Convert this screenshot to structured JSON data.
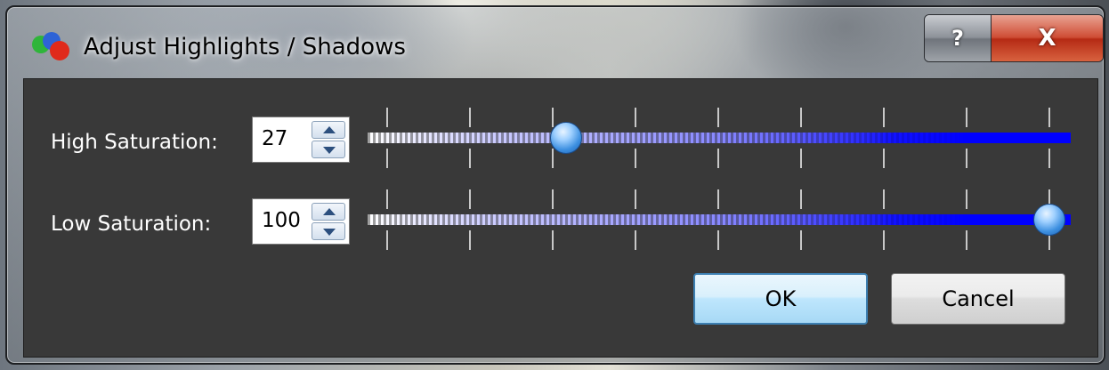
{
  "window": {
    "title": "Adjust Highlights / Shadows",
    "help_label": "?",
    "close_label": "X"
  },
  "controls": {
    "high": {
      "label": "High Saturation:",
      "value": "27",
      "slider_percent": 27
    },
    "low": {
      "label": "Low Saturation:",
      "value": "100",
      "slider_percent": 100
    }
  },
  "buttons": {
    "ok": "OK",
    "cancel": "Cancel"
  },
  "colors": {
    "client_bg": "#393939",
    "slider_accent": "#0000ff",
    "handle": "#3c8fe0"
  },
  "icons": {
    "app": "color-circles-icon",
    "help": "question-mark-icon",
    "close": "close-icon"
  }
}
